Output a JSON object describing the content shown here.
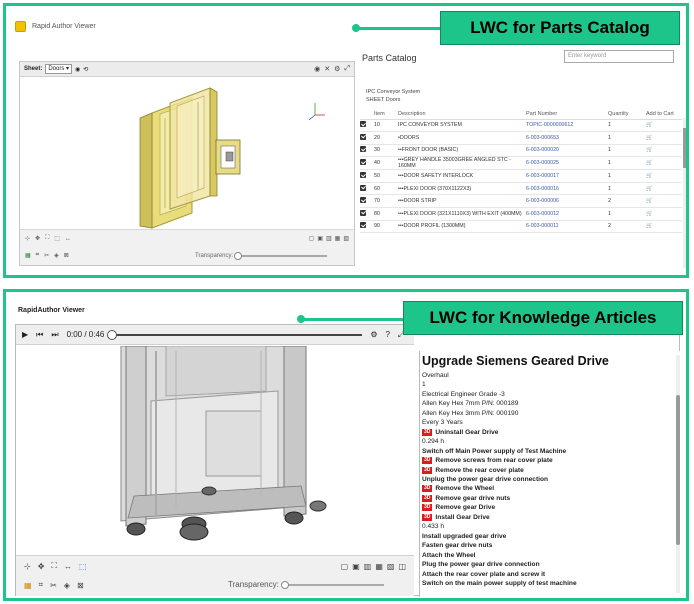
{
  "callouts": {
    "top": "LWC for Parts Catalog",
    "bottom": "LWC for Knowledge Articles"
  },
  "top_viewer": {
    "app_title": "Rapid Author Viewer",
    "sheet_label": "Sheet:",
    "sheet_value": "Doors ▾",
    "transparency_label": "Transparency:",
    "toolbar_glyphs": {
      "camera": "◉",
      "eye": "✕",
      "reset": "⟲",
      "gear": "⚙",
      "expand": "⤢",
      "zoom": "⊹",
      "move": "✥",
      "fit": "⛶",
      "section": "⬚",
      "measure": "↔",
      "box1": "▢",
      "box2": "▣",
      "box3": "▥",
      "box4": "▦",
      "box5": "▧",
      "tool1": "▦",
      "tool2": "⌗",
      "tool3": "✂",
      "tool4": "◈",
      "tool5": "⊠"
    }
  },
  "catalog": {
    "title": "Parts Catalog",
    "search_placeholder": "Enter keyword",
    "subtitle1": "IPC Conveyor System",
    "subtitle2": "SHEET Doors",
    "headers": [
      "",
      "Item",
      "Description",
      "Part Number",
      "Quantity",
      "Add to Cart"
    ],
    "rows": [
      {
        "item": "10",
        "desc": "IPC CONVEYOR SYSTEM",
        "pn": "TOPIC-0000000612",
        "qty": "1",
        "cart": "🛒"
      },
      {
        "item": "20",
        "desc": "•DOORS",
        "pn": "6-003-000653",
        "qty": "1",
        "cart": "🛒"
      },
      {
        "item": "30",
        "desc": "••FRONT DOOR (BASIC)",
        "pn": "6-003-000020",
        "qty": "1",
        "cart": "🛒"
      },
      {
        "item": "40",
        "desc": "•••GREY HANDLE 35003GREE ANGLED STC - 160MM",
        "pn": "6-003-000025",
        "qty": "1",
        "cart": "🛒"
      },
      {
        "item": "50",
        "desc": "•••DOOR SAFETY INTERLOCK",
        "pn": "6-003-000017",
        "qty": "1",
        "cart": "🛒"
      },
      {
        "item": "60",
        "desc": "•••PLEXI DOOR (370X1122X3)",
        "pn": "6-003-000016",
        "qty": "1",
        "cart": "🛒"
      },
      {
        "item": "70",
        "desc": "•••DOOR STRIP",
        "pn": "6-003-000006",
        "qty": "2",
        "cart": "🛒"
      },
      {
        "item": "80",
        "desc": "•••PLEXI DOOR (321X1110X3) WITH EXIT (400MM)",
        "pn": "6-003-000012",
        "qty": "1",
        "cart": "🛒"
      },
      {
        "item": "90",
        "desc": "•••DOOR PROFIL (1300MM)",
        "pn": "6-003-000011",
        "qty": "2",
        "cart": "🛒"
      }
    ]
  },
  "bottom_viewer": {
    "app_title": "RapidAuthor Viewer",
    "time": "0:00 / 0:46",
    "transparency_label": "Transparency:",
    "glyphs": {
      "play": "▶",
      "prev": "⏮",
      "next": "⏭",
      "gear": "⚙",
      "help": "?",
      "expand": "⤢",
      "zoom": "⊹",
      "move": "✥",
      "fit": "⛶",
      "measure": "↔",
      "section": "⬚",
      "box1": "▢",
      "box2": "▣",
      "box3": "▥",
      "box4": "▦",
      "box5": "▧",
      "box6": "◫",
      "tool1": "▦",
      "tool2": "⌗",
      "tool3": "✂",
      "tool4": "◈",
      "tool5": "⊠"
    }
  },
  "article": {
    "title": "Upgrade Siemens Geared Drive",
    "tag": "3D",
    "lines": [
      {
        "text": "Overhaul",
        "bold": false,
        "tag": false
      },
      {
        "text": "1",
        "bold": false,
        "tag": false
      },
      {
        "text": "Electrical Engineer Grade -3",
        "bold": false,
        "tag": false
      },
      {
        "text": "Allen Key Hex 7mm P/N: 000189",
        "bold": false,
        "tag": false
      },
      {
        "text": "Allen Key Hex 3mm P/N: 000190",
        "bold": false,
        "tag": false
      },
      {
        "text": "Every 3 Years",
        "bold": false,
        "tag": false
      },
      {
        "text": "Uninstall Gear Drive",
        "bold": true,
        "tag": true
      },
      {
        "text": "0.294 h",
        "bold": false,
        "tag": false
      },
      {
        "text": "Switch off Main Power supply of Test Machine",
        "bold": true,
        "tag": false
      },
      {
        "text": "Remove screws from rear cover plate",
        "bold": true,
        "tag": true
      },
      {
        "text": "Remove the rear cover plate",
        "bold": true,
        "tag": true
      },
      {
        "text": "Unplug the power gear drive connection",
        "bold": true,
        "tag": false
      },
      {
        "text": "Remove the Wheel",
        "bold": true,
        "tag": true
      },
      {
        "text": "Remove gear drive nuts",
        "bold": true,
        "tag": true
      },
      {
        "text": "Remove gear Drive",
        "bold": true,
        "tag": true
      },
      {
        "text": "Install Gear Drive",
        "bold": true,
        "tag": true
      },
      {
        "text": "0.433 h",
        "bold": false,
        "tag": false
      },
      {
        "text": "Install upgraded gear drive",
        "bold": true,
        "tag": false
      },
      {
        "text": "Fasten gear drive nuts",
        "bold": true,
        "tag": false
      },
      {
        "text": "Attach the Wheel",
        "bold": true,
        "tag": false
      },
      {
        "text": "Plug the power gear drive connection",
        "bold": true,
        "tag": false
      },
      {
        "text": "Attach the rear cover plate and screw it",
        "bold": true,
        "tag": false
      },
      {
        "text": "Switch on the main power supply of test machine",
        "bold": true,
        "tag": false
      }
    ]
  },
  "colors": {
    "accent": "#1ec58b",
    "tag_red": "#d81e1e",
    "link_blue": "#3b5aa8",
    "door_yellow": "#e6d96a"
  }
}
